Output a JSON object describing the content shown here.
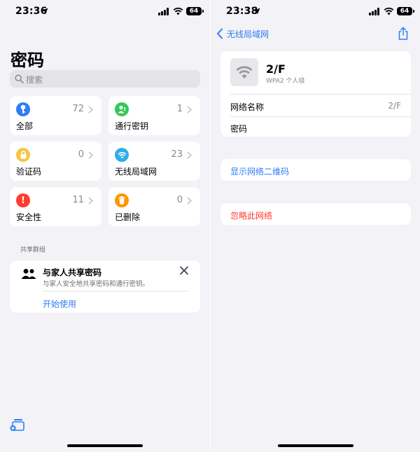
{
  "left": {
    "status": {
      "time": "23:36",
      "battery": "64"
    },
    "title": "密码",
    "search": {
      "placeholder": "搜索"
    },
    "tiles": [
      {
        "label": "全部",
        "count": "72",
        "icon": "key-icon",
        "color": "#2f7cf6"
      },
      {
        "label": "通行密钥",
        "count": "1",
        "icon": "passkey-person-icon",
        "color": "#34c759"
      },
      {
        "label": "验证码",
        "count": "0",
        "icon": "lock-icon",
        "color": "#f6c544"
      },
      {
        "label": "无线局域网",
        "count": "23",
        "icon": "wifi-icon",
        "color": "#32ade6"
      },
      {
        "label": "安全性",
        "count": "11",
        "icon": "exclamation-icon",
        "color": "#ff3b30"
      },
      {
        "label": "已删除",
        "count": "0",
        "icon": "trash-icon",
        "color": "#ff9500"
      }
    ],
    "shared_section": {
      "header": "共享群组",
      "card_title": "与家人共享密码",
      "card_subtitle": "与家人安全地共享密码和通行密钥。",
      "action": "开始使用"
    }
  },
  "right": {
    "status": {
      "time": "23:38",
      "battery": "64"
    },
    "nav": {
      "back_label": "无线局域网"
    },
    "network": {
      "name": "2/F",
      "security": "WPA2 个人级",
      "name_row_label": "网络名称",
      "name_row_value": "2/F",
      "password_row_label": "密码"
    },
    "qr_action": "显示网络二维码",
    "forget_action": "忽略此网络"
  },
  "colors": {
    "accent": "#2f7cf6",
    "destructive": "#ff3b30",
    "background": "#f2f2f7"
  }
}
